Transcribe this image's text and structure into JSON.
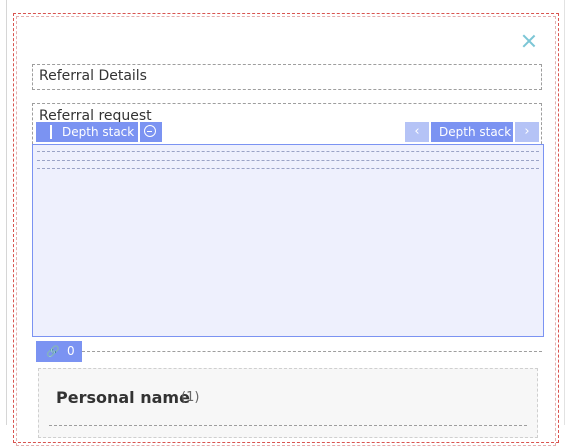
{
  "dialog": {
    "close_icon": "close-icon"
  },
  "sections": {
    "referral_details": {
      "title": "Referral Details"
    },
    "referral_request": {
      "title": "Referral request"
    }
  },
  "toolbar": {
    "left_label": "Depth stack",
    "left_menu_icon": "minus-circle-icon",
    "right_label": "Depth stack",
    "prev_icon": "chevron-left-icon",
    "next_icon": "chevron-right-icon",
    "prev_glyph": "‹",
    "next_glyph": "›"
  },
  "links": {
    "icon": "link-icon",
    "count": "0"
  },
  "card": {
    "title": "Personal name",
    "count": "(1)"
  },
  "colors": {
    "accent": "#7b93f2",
    "accent_light": "#b5c3f6",
    "stack_bg": "#eef0fd",
    "close": "#7cc6d6"
  }
}
